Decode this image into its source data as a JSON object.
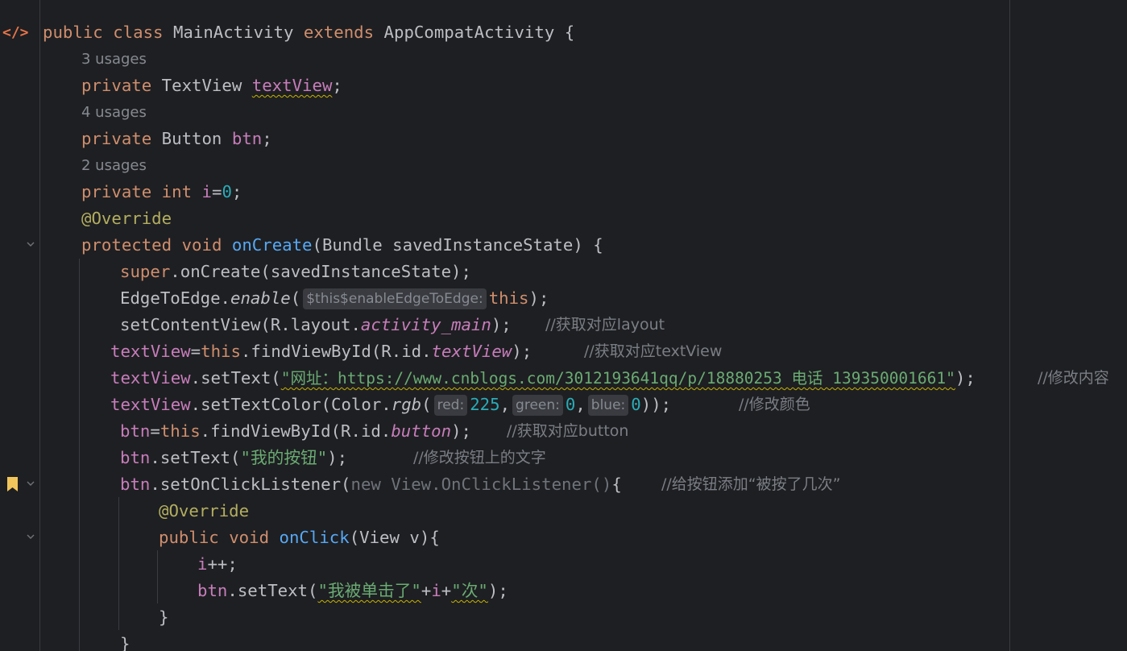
{
  "gutter": {
    "file_icon": "code-file-icon",
    "bookmark_icon": "bookmark-icon",
    "fold_icon": "chevron-down-icon"
  },
  "usages": {
    "textView": "3 usages",
    "btn": "4 usages",
    "i": "2 usages"
  },
  "code": {
    "l1": {
      "kw1": "public",
      "kw2": "class",
      "name": "MainActivity",
      "kw3": "extends",
      "base": "AppCompatActivity",
      "brace": "{"
    },
    "l2": {
      "kw": "private",
      "type": "TextView",
      "name": "textView",
      "end": ";"
    },
    "l3": {
      "kw": "private",
      "type": "Button",
      "name": "btn",
      "end": ";"
    },
    "l4": {
      "kw1": "private",
      "kw2": "int",
      "name": "i",
      "eq": "=",
      "num": "0",
      "end": ";"
    },
    "l5": {
      "ann": "@Override"
    },
    "l6": {
      "kw1": "protected",
      "kw2": "void",
      "fn": "onCreate",
      "params": "(Bundle savedInstanceState) {"
    },
    "l7": {
      "kw": "super",
      "rest": ".onCreate(savedInstanceState);"
    },
    "l8": {
      "cls": "EdgeToEdge.",
      "fn": "enable",
      "open": "(",
      "hint": "$this$enableEdgeToEdge:",
      "kw": "this",
      "close": ");"
    },
    "l9": {
      "pre": "setContentView(R.layout.",
      "field": "activity_main",
      "post": ");",
      "comment": "//获取对应layout"
    },
    "l10": {
      "field": "textView",
      "eq": "=",
      "kw": "this",
      "mid": ".findViewById(R.id.",
      "sfield": "textView",
      "post": ");",
      "comment": "//获取对应textView"
    },
    "l11": {
      "field": "textView",
      "mid": ".setText(",
      "str": "\"网址：https://www.cnblogs.com/3012193641qq/p/18880253 电话 139350001661\"",
      "post": ");",
      "comment": "//修改内容"
    },
    "l12": {
      "field": "textView",
      "mid": ".setTextColor(Color.",
      "fn": "rgb",
      "open": "(",
      "hint_red": "red:",
      "red": "225",
      "comma1": ",",
      "hint_green": "green:",
      "green": "0",
      "comma2": ",",
      "hint_blue": "blue:",
      "blue": "0",
      "post": "));",
      "comment": "//修改颜色"
    },
    "l13": {
      "field": "btn",
      "eq": "=",
      "kw": "this",
      "mid": ".findViewById(R.id.",
      "sfield": "button",
      "post": ");",
      "comment": "//获取对应button"
    },
    "l14": {
      "field": "btn",
      "mid": ".setText(",
      "str": "\"我的按钮\"",
      "post": ");",
      "comment": "//修改按钮上的文字"
    },
    "l15": {
      "field": "btn",
      "mid": ".setOnClickListener(",
      "dim": "new View.OnClickListener()",
      "post": "{",
      "comment": "//给按钮添加“被按了几次”"
    },
    "l16": {
      "ann": "@Override"
    },
    "l17": {
      "kw1": "public",
      "kw2": "void",
      "fn": "onClick",
      "params": "(View v){"
    },
    "l18": {
      "field": "i",
      "post": "++;"
    },
    "l19": {
      "field": "btn",
      "mid": ".setText(",
      "str1": "\"我被单击了\"",
      "plus1": "+",
      "var": "i",
      "plus2": "+",
      "str2": "\"次\"",
      "post": ");"
    },
    "l20": {
      "brace": "}"
    },
    "l21": {
      "brace": "}"
    }
  }
}
